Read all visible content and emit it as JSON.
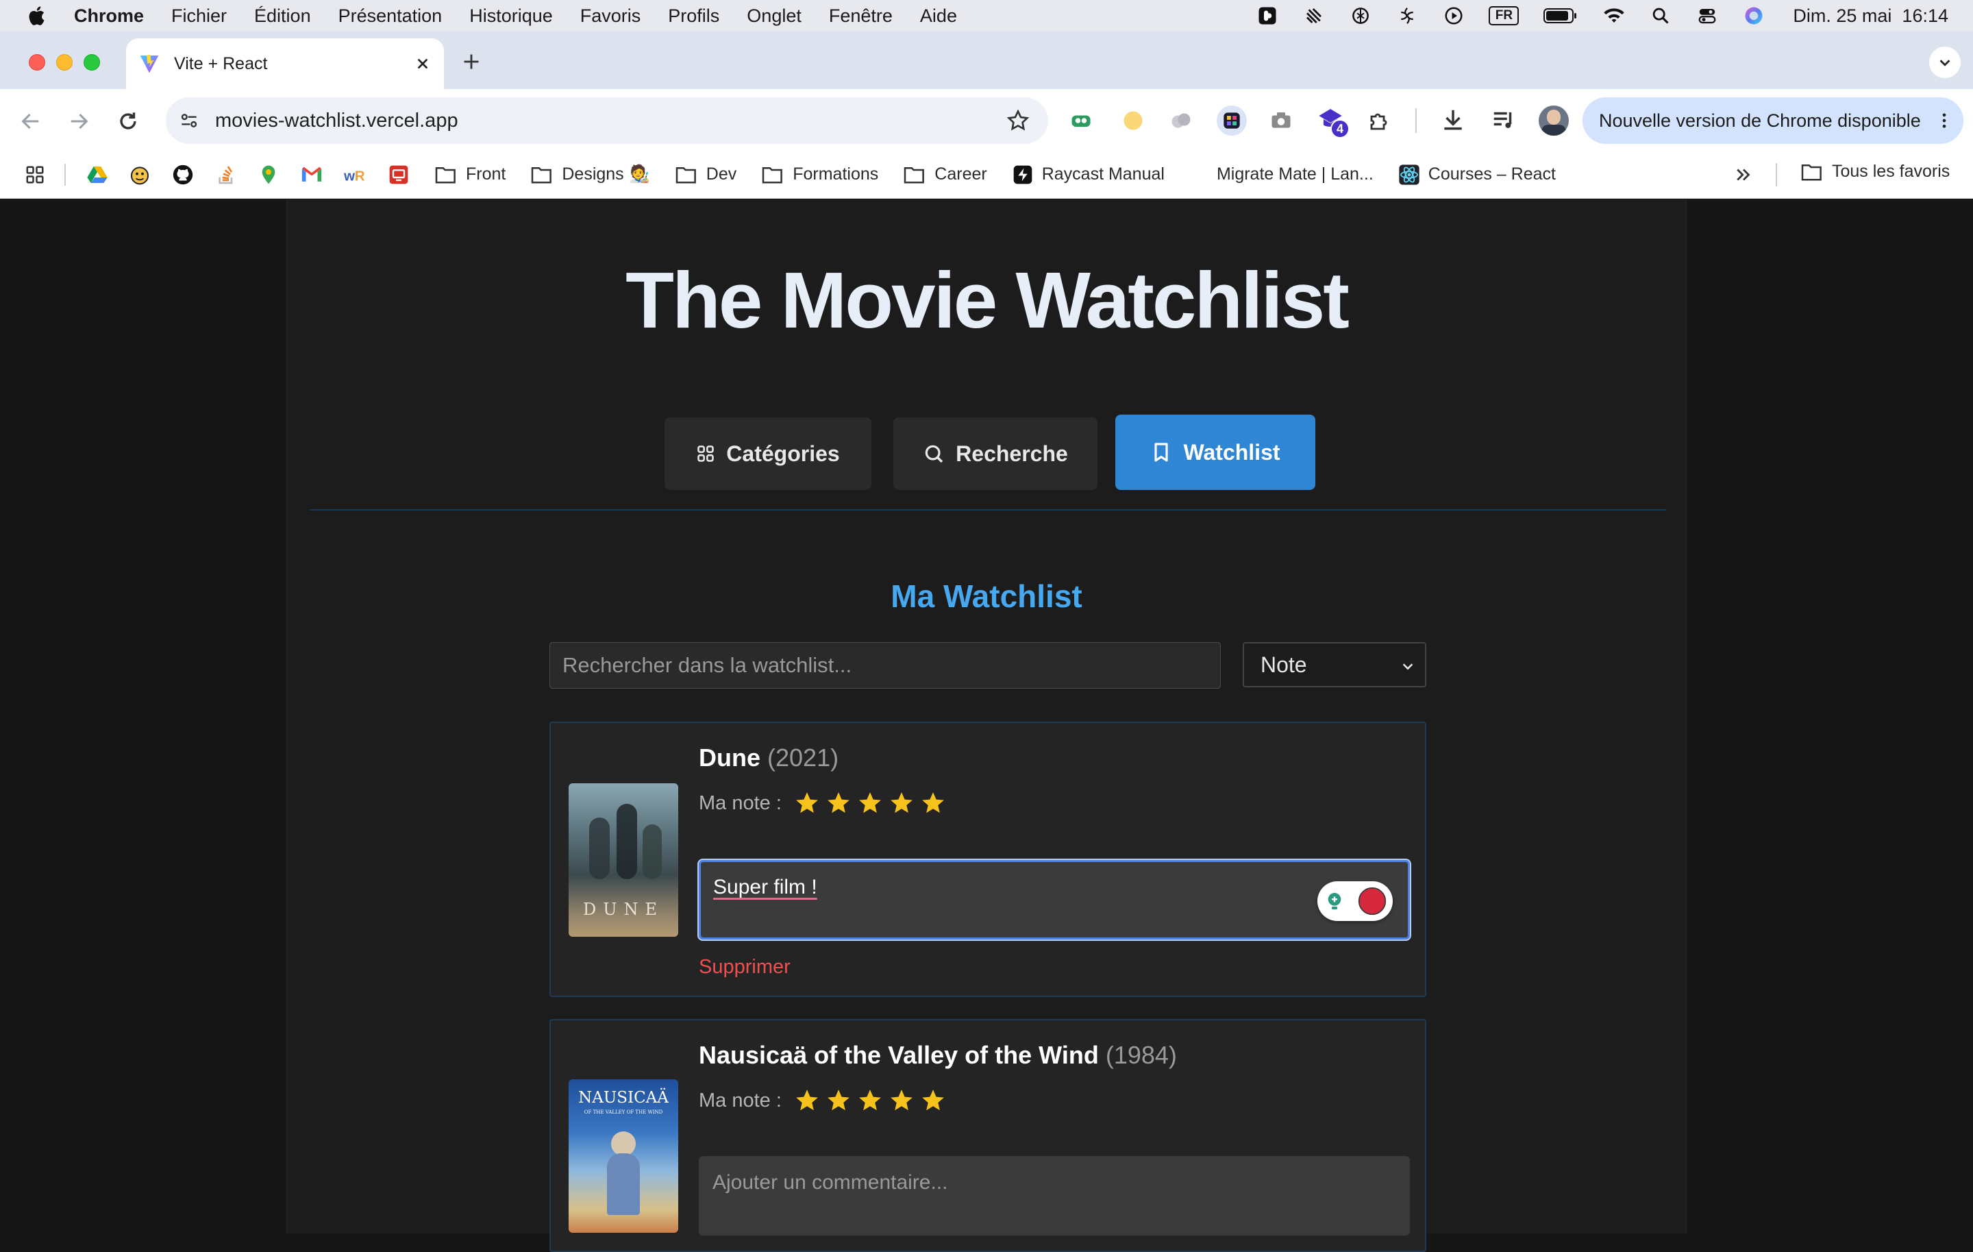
{
  "menubar": {
    "app": "Chrome",
    "items": [
      "Fichier",
      "Édition",
      "Présentation",
      "Historique",
      "Favoris",
      "Profils",
      "Onglet",
      "Fenêtre",
      "Aide"
    ],
    "input_lang": "FR",
    "datetime": "Dim. 25 mai  16:14"
  },
  "browser": {
    "tab_title": "Vite + React",
    "url": "movies-watchlist.vercel.app",
    "update_label": "Nouvelle version de Chrome disponible",
    "extension_badge": "4",
    "bookmarks": [
      {
        "label": "Front",
        "icon": "folder-icon"
      },
      {
        "label": "Designs 🧑‍🎨",
        "icon": "folder-icon"
      },
      {
        "label": "Dev",
        "icon": "folder-icon"
      },
      {
        "label": "Formations",
        "icon": "folder-icon"
      },
      {
        "label": "Career",
        "icon": "folder-icon"
      },
      {
        "label": "Raycast Manual",
        "icon": "raycast-icon"
      },
      {
        "label": "Migrate Mate | Lan...",
        "icon": "none"
      },
      {
        "label": "Courses – React",
        "icon": "react-icon"
      }
    ],
    "all_bookmarks": "Tous les favoris"
  },
  "app": {
    "title": "The Movie Watchlist",
    "nav": {
      "categories": "Catégories",
      "search": "Recherche",
      "watchlist": "Watchlist",
      "active": "watchlist"
    },
    "section_title": "Ma Watchlist",
    "search_placeholder": "Rechercher dans la watchlist...",
    "sort_selected": "Note",
    "movies": [
      {
        "title": "Dune",
        "year": "(2021)",
        "rating_label": "Ma note :",
        "rating": 5,
        "comment": "Super film !",
        "delete_label": "Supprimer",
        "poster_text": "DUNE"
      },
      {
        "title": "Nausicaä of the Valley of the Wind",
        "year": "(1984)",
        "rating_label": "Ma note :",
        "rating": 5,
        "comment_placeholder": "Ajouter un commentaire...",
        "poster_text": "NAUSICAÄ",
        "poster_subtitle": "OF THE VALLEY OF THE WIND"
      }
    ]
  },
  "colors": {
    "accent": "#2f86d4",
    "section_title": "#46a8f0",
    "delete": "#ef5050",
    "star": "#f7c21c"
  }
}
